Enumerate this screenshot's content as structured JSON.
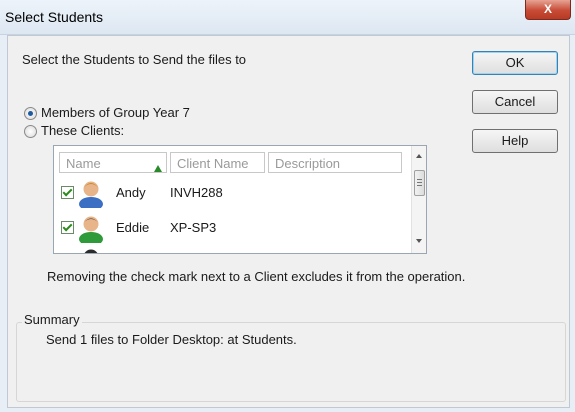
{
  "window": {
    "title": "Select Students",
    "close_label": "X"
  },
  "instructions": "Select the Students to Send the files to",
  "buttons": {
    "ok": "OK",
    "cancel": "Cancel",
    "help": "Help"
  },
  "radios": [
    {
      "label": "Members of Group Year 7",
      "selected": true
    },
    {
      "label": "These Clients:",
      "selected": false
    }
  ],
  "list": {
    "columns": [
      "Name",
      "Client Name",
      "Description"
    ],
    "sort_column": "Name",
    "rows": [
      {
        "checked": true,
        "name": "Andy",
        "client": "INVH288",
        "description": "",
        "icon": "user-avatar-icon"
      },
      {
        "checked": true,
        "name": "Eddie",
        "client": "XP-SP3",
        "description": "",
        "icon": "user-avatar-icon"
      }
    ]
  },
  "note": "Removing the check mark next to a Client excludes it from the operation.",
  "summary": {
    "label": "Summary",
    "text": "Send 1 files to Folder Desktop: at Students."
  },
  "colors": {
    "title_bg": "#dde7f2",
    "close_red": "#c74b36",
    "dialog_bg": "#f0f0f0",
    "check_green": "#2c8a1e",
    "sort_arrow": "#2a8a2a"
  }
}
